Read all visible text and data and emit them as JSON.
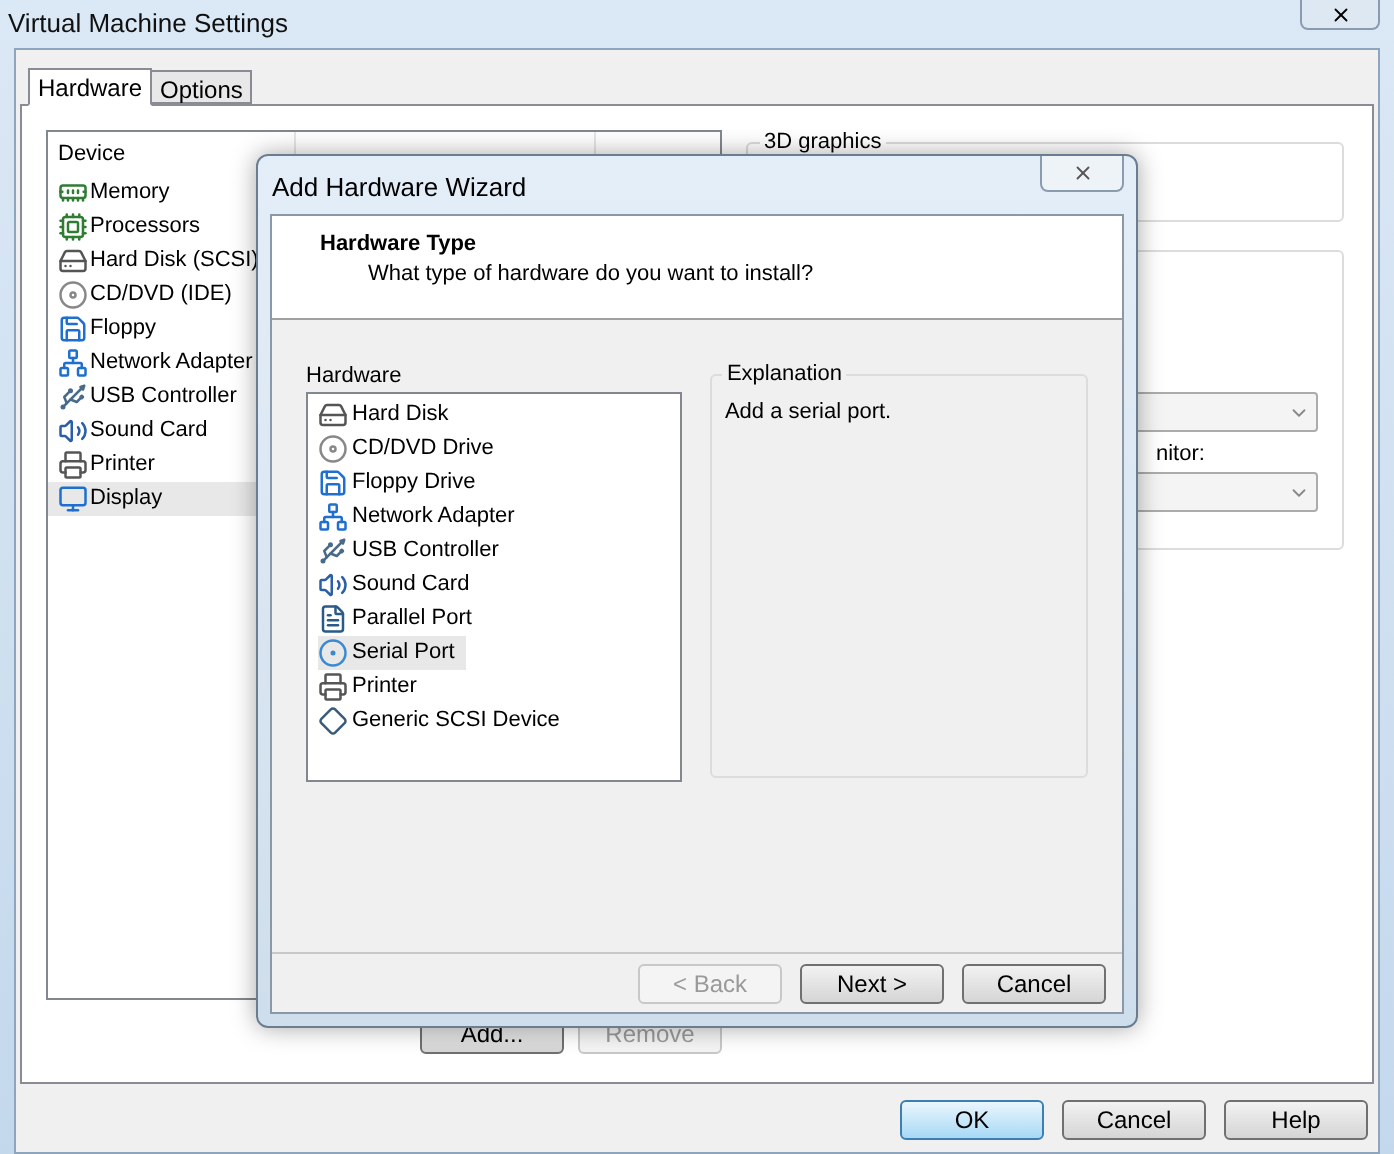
{
  "window": {
    "title": "Virtual Machine Settings"
  },
  "tabs": [
    {
      "label": "Hardware",
      "selected": true
    },
    {
      "label": "Options",
      "selected": false
    }
  ],
  "device_table": {
    "columns": [
      "Device"
    ],
    "rows": [
      {
        "kind": "memory",
        "name": "Memory",
        "selected": false
      },
      {
        "kind": "cpu",
        "name": "Processors",
        "selected": false
      },
      {
        "kind": "disk",
        "name": "Hard Disk (SCSI)",
        "selected": false
      },
      {
        "kind": "cd",
        "name": "CD/DVD (IDE)",
        "selected": false
      },
      {
        "kind": "floppy",
        "name": "Floppy",
        "selected": false
      },
      {
        "kind": "network",
        "name": "Network Adapter",
        "selected": false
      },
      {
        "kind": "usb",
        "name": "USB Controller",
        "selected": false
      },
      {
        "kind": "sound",
        "name": "Sound Card",
        "selected": false
      },
      {
        "kind": "printer",
        "name": "Printer",
        "selected": false
      },
      {
        "kind": "display",
        "name": "Display",
        "selected": true
      }
    ]
  },
  "groups": [
    {
      "title": "3D graphics"
    }
  ],
  "monitor_label": "nitor:",
  "list_buttons": [
    {
      "label": "Add...",
      "disabled": false
    },
    {
      "label": "Remove",
      "disabled": true
    }
  ],
  "buttons": [
    {
      "label": "OK",
      "default": true
    },
    {
      "label": "Cancel",
      "default": false
    },
    {
      "label": "Help",
      "default": false
    }
  ],
  "dialog": {
    "title": "Add Hardware Wizard",
    "heading": "Hardware Type",
    "subheading": "What type of hardware do you want to install?",
    "list_label": "Hardware",
    "items": [
      {
        "kind": "disk",
        "name": "Hard Disk",
        "selected": false
      },
      {
        "kind": "cd",
        "name": "CD/DVD Drive",
        "selected": false
      },
      {
        "kind": "floppy",
        "name": "Floppy Drive",
        "selected": false
      },
      {
        "kind": "network",
        "name": "Network Adapter",
        "selected": false
      },
      {
        "kind": "usb",
        "name": "USB Controller",
        "selected": false
      },
      {
        "kind": "sound",
        "name": "Sound Card",
        "selected": false
      },
      {
        "kind": "parallel",
        "name": "Parallel Port",
        "selected": false
      },
      {
        "kind": "serial",
        "name": "Serial Port",
        "selected": true
      },
      {
        "kind": "printer",
        "name": "Printer",
        "selected": false
      },
      {
        "kind": "scsi",
        "name": "Generic SCSI Device",
        "selected": false
      }
    ],
    "explanation_title": "Explanation",
    "explanation": "Add a serial port.",
    "buttons": [
      {
        "label": "< Back",
        "disabled": true
      },
      {
        "label": "Next >",
        "disabled": false
      },
      {
        "label": "Cancel",
        "disabled": false
      }
    ]
  }
}
